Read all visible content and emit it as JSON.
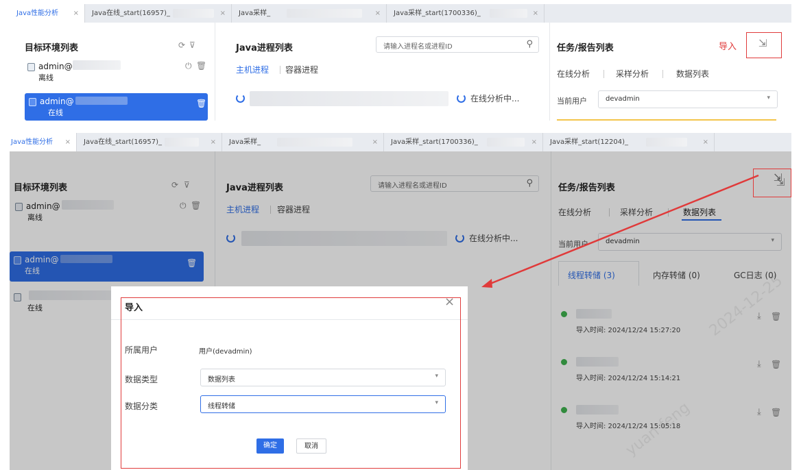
{
  "tabs": [
    {
      "label": "Java性能分析"
    },
    {
      "label": "Java在线_start(16957)_"
    },
    {
      "label": "Java采样_"
    },
    {
      "label": "Java采样_start(1700336)_"
    },
    {
      "label": "Java采样_start(12204)_"
    }
  ],
  "env_panel": {
    "title": "目标环境列表",
    "items": [
      {
        "name": "admin@",
        "status": "离线"
      },
      {
        "name": "admin@",
        "status": "在线"
      },
      {
        "name": "",
        "status": "在线"
      }
    ]
  },
  "proc_panel": {
    "title": "Java进程列表",
    "search_placeholder": "请输入进程名或进程ID",
    "tabs": [
      "主机进程",
      "容器进程"
    ],
    "online_status": "在线分析中..."
  },
  "task_panel": {
    "title": "任务/报告列表",
    "import_annotation": "导入",
    "tabs": [
      "在线分析",
      "采样分析",
      "数据列表"
    ],
    "user_label": "当前用户",
    "user_value": "devadmin",
    "data_tabs": [
      "线程转储 (3)",
      "内存转储 (0)",
      "GC日志 (0)"
    ],
    "files": [
      {
        "time": "导入时间: 2024/12/24 15:27:20"
      },
      {
        "time": "导入时间: 2024/12/24 15:14:21"
      },
      {
        "time": "导入时间: 2024/12/24 15:05:18"
      }
    ]
  },
  "dialog": {
    "title": "导入",
    "owner_label": "所属用户",
    "owner_value": "用户(devadmin)",
    "type_label": "数据类型",
    "type_value": "数据列表",
    "category_label": "数据分类",
    "category_value": "线程转储",
    "confirm": "确定",
    "cancel": "取消"
  },
  "icons": {
    "close": "×",
    "search": "⚲",
    "import": "⇲",
    "download": "⤓",
    "trash": "🗑"
  },
  "colors": {
    "accent": "#2f6ee6",
    "annotation": "#e03a3a",
    "success": "#3fb34f"
  }
}
